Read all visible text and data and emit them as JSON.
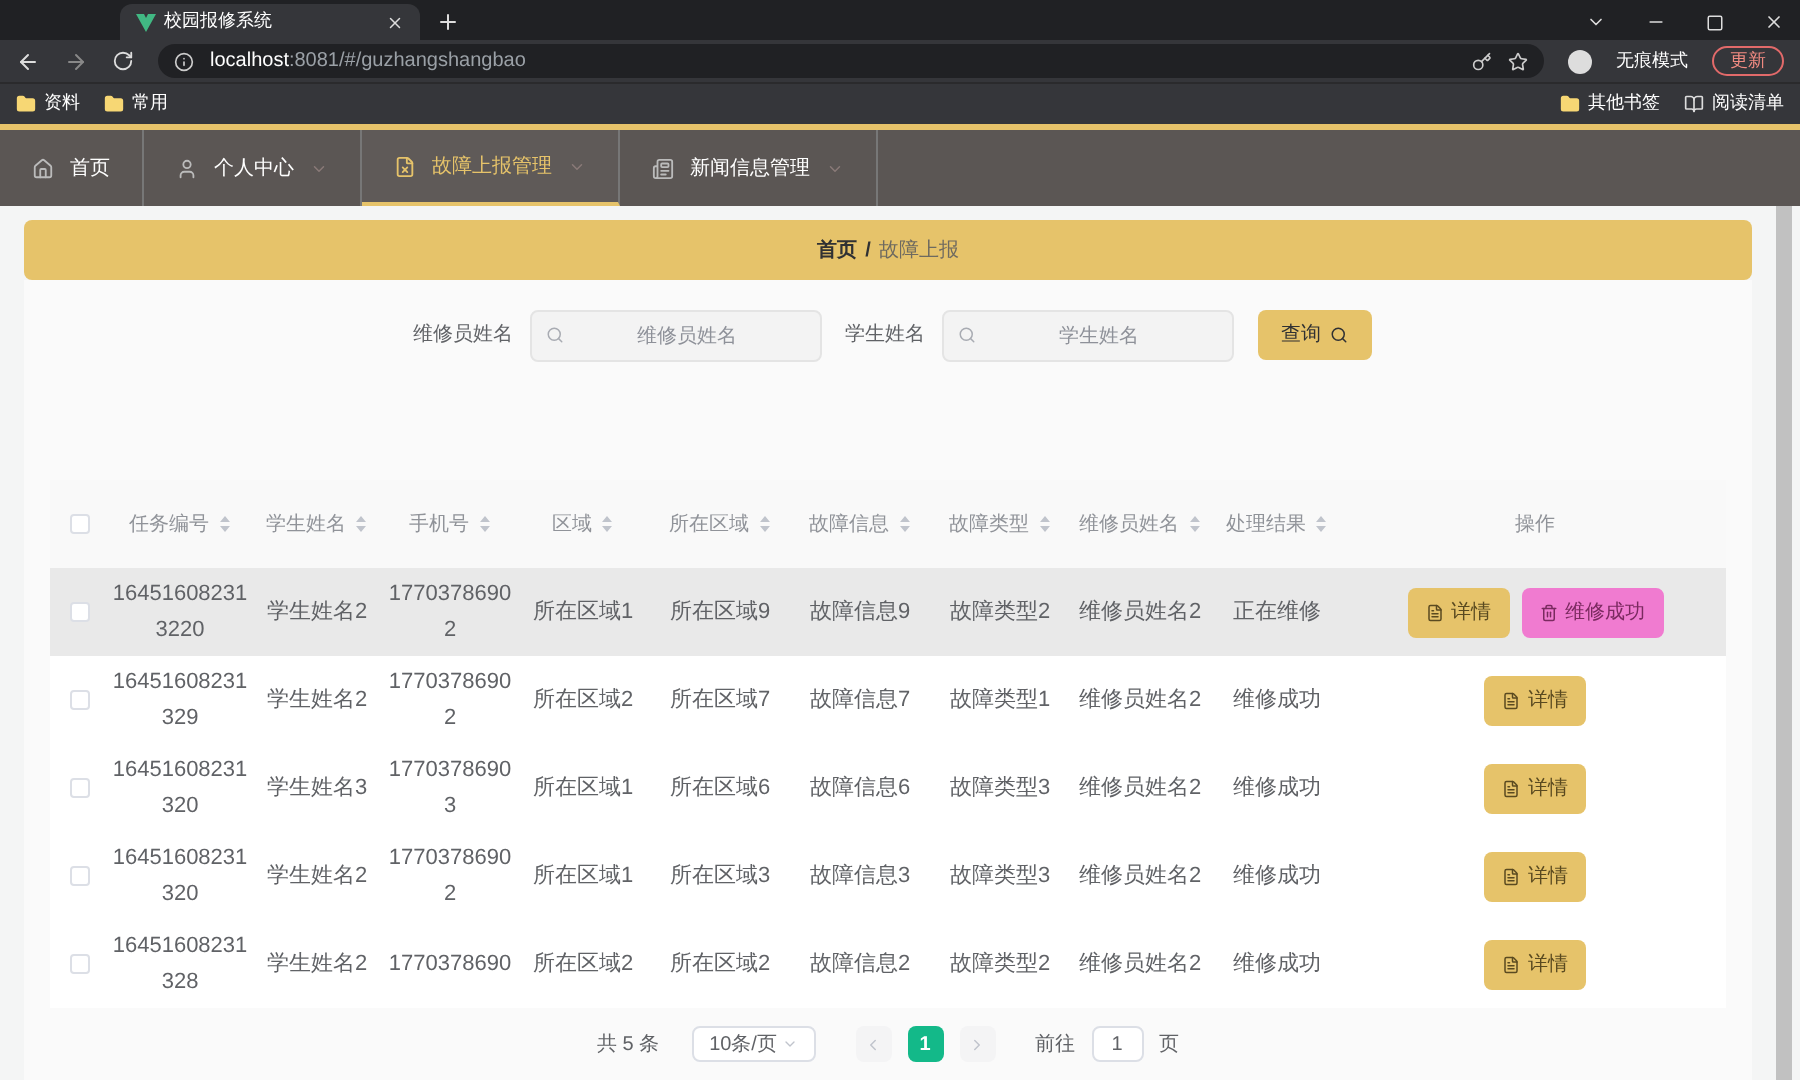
{
  "browser": {
    "tab_title": "校园报修系统",
    "url_host": "localhost",
    "url_rest": ":8081/#/guzhangshangbao",
    "incognito_label": "无痕模式",
    "update_label": "更新",
    "bookmarks": [
      "资料",
      "常用"
    ],
    "bookmarks_right": [
      "其他书签",
      "阅读清单"
    ]
  },
  "nav": [
    {
      "label": "首页",
      "selected": false,
      "submenu": false
    },
    {
      "label": "个人中心",
      "selected": false,
      "submenu": true
    },
    {
      "label": "故障上报管理",
      "selected": true,
      "submenu": true
    },
    {
      "label": "新闻信息管理",
      "selected": false,
      "submenu": true
    }
  ],
  "breadcrumb": {
    "home": "首页",
    "separator": "/",
    "current": "故障上报"
  },
  "search": {
    "fields": [
      {
        "label": "维修员姓名",
        "placeholder": "维修员姓名"
      },
      {
        "label": "学生姓名",
        "placeholder": "学生姓名"
      }
    ],
    "button": "查询"
  },
  "table": {
    "select_all_checked": false,
    "columns": [
      {
        "label": "任务编号",
        "sortable": true
      },
      {
        "label": "学生姓名",
        "sortable": true
      },
      {
        "label": "手机号",
        "sortable": true
      },
      {
        "label": "区域",
        "sortable": true
      },
      {
        "label": "所在区域",
        "sortable": true
      },
      {
        "label": "故障信息",
        "sortable": true
      },
      {
        "label": "故障类型",
        "sortable": true
      },
      {
        "label": "维修员姓名",
        "sortable": true
      },
      {
        "label": "处理结果",
        "sortable": true
      },
      {
        "label": "操作",
        "sortable": false
      }
    ],
    "rows": [
      {
        "highlighted": true,
        "checked": false,
        "cells": [
          "16451608231 3220",
          "学生姓名2",
          "1770378690 2",
          "所在区域1",
          "所在区域9",
          "故障信息9",
          "故障类型2",
          "维修员姓名2",
          "正在维修"
        ],
        "actions": [
          {
            "kind": "detail",
            "label": "详情"
          },
          {
            "kind": "repair",
            "label": "维修成功"
          }
        ]
      },
      {
        "highlighted": false,
        "checked": false,
        "cells": [
          "16451608231 329",
          "学生姓名2",
          "1770378690 2",
          "所在区域2",
          "所在区域7",
          "故障信息7",
          "故障类型1",
          "维修员姓名2",
          "维修成功"
        ],
        "actions": [
          {
            "kind": "detail",
            "label": "详情"
          }
        ]
      },
      {
        "highlighted": false,
        "checked": false,
        "cells": [
          "16451608231 320",
          "学生姓名3",
          "1770378690 3",
          "所在区域1",
          "所在区域6",
          "故障信息6",
          "故障类型3",
          "维修员姓名2",
          "维修成功"
        ],
        "actions": [
          {
            "kind": "detail",
            "label": "详情"
          }
        ]
      },
      {
        "highlighted": false,
        "checked": false,
        "cells": [
          "16451608231 320",
          "学生姓名2",
          "1770378690 2",
          "所在区域1",
          "所在区域3",
          "故障信息3",
          "故障类型3",
          "维修员姓名2",
          "维修成功"
        ],
        "actions": [
          {
            "kind": "detail",
            "label": "详情"
          }
        ]
      },
      {
        "highlighted": false,
        "checked": false,
        "cells": [
          "16451608231 328",
          "学生姓名2",
          "1770378690",
          "所在区域2",
          "所在区域2",
          "故障信息2",
          "故障类型2",
          "维修员姓名2",
          "维修成功"
        ],
        "actions": [
          {
            "kind": "detail",
            "label": "详情"
          }
        ]
      }
    ]
  },
  "pagination": {
    "total": "共 5 条",
    "page_size": "10条/页",
    "pages": [
      {
        "label": "1",
        "selected": true
      }
    ],
    "goto_label": "前往",
    "goto_value": "1",
    "page_suffix": "页"
  }
}
